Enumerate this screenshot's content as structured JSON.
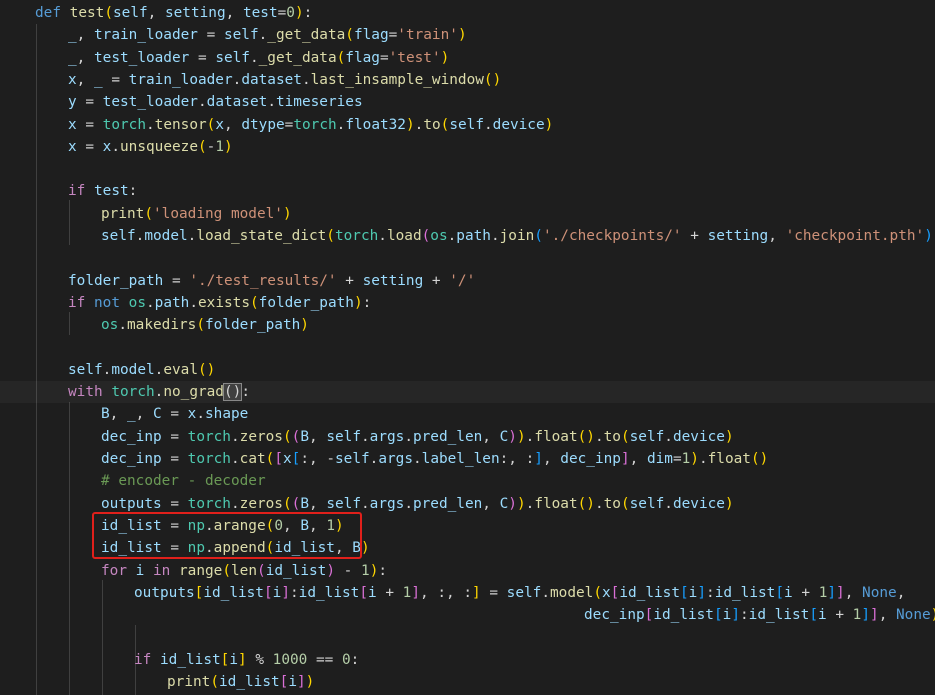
{
  "editor": {
    "lines": [
      [
        [
          "kw",
          "def"
        ],
        [
          "op",
          " "
        ],
        [
          "fn",
          "test"
        ],
        [
          "b1",
          "("
        ],
        [
          "var",
          "self"
        ],
        [
          "op",
          ", "
        ],
        [
          "var",
          "setting"
        ],
        [
          "op",
          ", "
        ],
        [
          "var",
          "test"
        ],
        [
          "op",
          "="
        ],
        [
          "num",
          "0"
        ],
        [
          "b1",
          ")"
        ],
        [
          "op",
          ":"
        ]
      ],
      [
        [
          "var",
          "_"
        ],
        [
          "op",
          ", "
        ],
        [
          "var",
          "train_loader"
        ],
        [
          "op",
          " = "
        ],
        [
          "var",
          "self"
        ],
        [
          "op",
          "."
        ],
        [
          "fn",
          "_get_data"
        ],
        [
          "b1",
          "("
        ],
        [
          "var",
          "flag"
        ],
        [
          "op",
          "="
        ],
        [
          "str",
          "'train'"
        ],
        [
          "b1",
          ")"
        ]
      ],
      [
        [
          "var",
          "_"
        ],
        [
          "op",
          ", "
        ],
        [
          "var",
          "test_loader"
        ],
        [
          "op",
          " = "
        ],
        [
          "var",
          "self"
        ],
        [
          "op",
          "."
        ],
        [
          "fn",
          "_get_data"
        ],
        [
          "b1",
          "("
        ],
        [
          "var",
          "flag"
        ],
        [
          "op",
          "="
        ],
        [
          "str",
          "'test'"
        ],
        [
          "b1",
          ")"
        ]
      ],
      [
        [
          "var",
          "x"
        ],
        [
          "op",
          ", "
        ],
        [
          "var",
          "_"
        ],
        [
          "op",
          " = "
        ],
        [
          "var",
          "train_loader"
        ],
        [
          "op",
          "."
        ],
        [
          "var",
          "dataset"
        ],
        [
          "op",
          "."
        ],
        [
          "fn",
          "last_insample_window"
        ],
        [
          "b1",
          "()"
        ]
      ],
      [
        [
          "var",
          "y"
        ],
        [
          "op",
          " = "
        ],
        [
          "var",
          "test_loader"
        ],
        [
          "op",
          "."
        ],
        [
          "var",
          "dataset"
        ],
        [
          "op",
          "."
        ],
        [
          "var",
          "timeseries"
        ]
      ],
      [
        [
          "var",
          "x"
        ],
        [
          "op",
          " = "
        ],
        [
          "cls",
          "torch"
        ],
        [
          "op",
          "."
        ],
        [
          "fn",
          "tensor"
        ],
        [
          "b1",
          "("
        ],
        [
          "var",
          "x"
        ],
        [
          "op",
          ", "
        ],
        [
          "var",
          "dtype"
        ],
        [
          "op",
          "="
        ],
        [
          "cls",
          "torch"
        ],
        [
          "op",
          "."
        ],
        [
          "var",
          "float32"
        ],
        [
          "b1",
          ")"
        ],
        [
          "op",
          "."
        ],
        [
          "fn",
          "to"
        ],
        [
          "b1",
          "("
        ],
        [
          "var",
          "self"
        ],
        [
          "op",
          "."
        ],
        [
          "var",
          "device"
        ],
        [
          "b1",
          ")"
        ]
      ],
      [
        [
          "var",
          "x"
        ],
        [
          "op",
          " = "
        ],
        [
          "var",
          "x"
        ],
        [
          "op",
          "."
        ],
        [
          "fn",
          "unsqueeze"
        ],
        [
          "b1",
          "("
        ],
        [
          "op",
          "-"
        ],
        [
          "num",
          "1"
        ],
        [
          "b1",
          ")"
        ]
      ],
      [],
      [
        [
          "ctl",
          "if"
        ],
        [
          "op",
          " "
        ],
        [
          "var",
          "test"
        ],
        [
          "op",
          ":"
        ]
      ],
      [
        [
          "fn",
          "print"
        ],
        [
          "b1",
          "("
        ],
        [
          "str",
          "'loading model'"
        ],
        [
          "b1",
          ")"
        ]
      ],
      [
        [
          "var",
          "self"
        ],
        [
          "op",
          "."
        ],
        [
          "var",
          "model"
        ],
        [
          "op",
          "."
        ],
        [
          "fn",
          "load_state_dict"
        ],
        [
          "b1",
          "("
        ],
        [
          "cls",
          "torch"
        ],
        [
          "op",
          "."
        ],
        [
          "fn",
          "load"
        ],
        [
          "b2",
          "("
        ],
        [
          "cls",
          "os"
        ],
        [
          "op",
          "."
        ],
        [
          "var",
          "path"
        ],
        [
          "op",
          "."
        ],
        [
          "fn",
          "join"
        ],
        [
          "b3",
          "("
        ],
        [
          "str",
          "'./checkpoints/'"
        ],
        [
          "op",
          " + "
        ],
        [
          "var",
          "setting"
        ],
        [
          "op",
          ", "
        ],
        [
          "str",
          "'checkpoint.pth'"
        ],
        [
          "b3",
          ")"
        ],
        [
          "b2",
          ")"
        ],
        [
          "b1",
          ")"
        ]
      ],
      [],
      [
        [
          "var",
          "folder_path"
        ],
        [
          "op",
          " = "
        ],
        [
          "str",
          "'./test_results/'"
        ],
        [
          "op",
          " + "
        ],
        [
          "var",
          "setting"
        ],
        [
          "op",
          " + "
        ],
        [
          "str",
          "'/'"
        ]
      ],
      [
        [
          "ctl",
          "if"
        ],
        [
          "op",
          " "
        ],
        [
          "kw",
          "not"
        ],
        [
          "op",
          " "
        ],
        [
          "cls",
          "os"
        ],
        [
          "op",
          "."
        ],
        [
          "var",
          "path"
        ],
        [
          "op",
          "."
        ],
        [
          "fn",
          "exists"
        ],
        [
          "b1",
          "("
        ],
        [
          "var",
          "folder_path"
        ],
        [
          "b1",
          ")"
        ],
        [
          "op",
          ":"
        ]
      ],
      [
        [
          "cls",
          "os"
        ],
        [
          "op",
          "."
        ],
        [
          "fn",
          "makedirs"
        ],
        [
          "b1",
          "("
        ],
        [
          "var",
          "folder_path"
        ],
        [
          "b1",
          ")"
        ]
      ],
      [],
      [
        [
          "var",
          "self"
        ],
        [
          "op",
          "."
        ],
        [
          "var",
          "model"
        ],
        [
          "op",
          "."
        ],
        [
          "fn",
          "eval"
        ],
        [
          "b1",
          "()"
        ]
      ],
      [
        [
          "ctl",
          "with"
        ],
        [
          "op",
          " "
        ],
        [
          "cls",
          "torch"
        ],
        [
          "op",
          "."
        ],
        [
          "fn",
          "no_grad"
        ],
        [
          "bm",
          "()"
        ],
        [
          "op",
          ":"
        ]
      ],
      [
        [
          "var",
          "B"
        ],
        [
          "op",
          ", "
        ],
        [
          "var",
          "_"
        ],
        [
          "op",
          ", "
        ],
        [
          "var",
          "C"
        ],
        [
          "op",
          " = "
        ],
        [
          "var",
          "x"
        ],
        [
          "op",
          "."
        ],
        [
          "var",
          "shape"
        ]
      ],
      [
        [
          "var",
          "dec_inp"
        ],
        [
          "op",
          " = "
        ],
        [
          "cls",
          "torch"
        ],
        [
          "op",
          "."
        ],
        [
          "fn",
          "zeros"
        ],
        [
          "b1",
          "("
        ],
        [
          "b2",
          "("
        ],
        [
          "var",
          "B"
        ],
        [
          "op",
          ", "
        ],
        [
          "var",
          "self"
        ],
        [
          "op",
          "."
        ],
        [
          "var",
          "args"
        ],
        [
          "op",
          "."
        ],
        [
          "var",
          "pred_len"
        ],
        [
          "op",
          ", "
        ],
        [
          "var",
          "C"
        ],
        [
          "b2",
          ")"
        ],
        [
          "b1",
          ")"
        ],
        [
          "op",
          "."
        ],
        [
          "fn",
          "float"
        ],
        [
          "b1",
          "()"
        ],
        [
          "op",
          "."
        ],
        [
          "fn",
          "to"
        ],
        [
          "b1",
          "("
        ],
        [
          "var",
          "self"
        ],
        [
          "op",
          "."
        ],
        [
          "var",
          "device"
        ],
        [
          "b1",
          ")"
        ]
      ],
      [
        [
          "var",
          "dec_inp"
        ],
        [
          "op",
          " = "
        ],
        [
          "cls",
          "torch"
        ],
        [
          "op",
          "."
        ],
        [
          "fn",
          "cat"
        ],
        [
          "b1",
          "("
        ],
        [
          "b2",
          "["
        ],
        [
          "var",
          "x"
        ],
        [
          "b3",
          "["
        ],
        [
          "op",
          ":, -"
        ],
        [
          "var",
          "self"
        ],
        [
          "op",
          "."
        ],
        [
          "var",
          "args"
        ],
        [
          "op",
          "."
        ],
        [
          "var",
          "label_len"
        ],
        [
          "op",
          ":, :"
        ],
        [
          "b3",
          "]"
        ],
        [
          "op",
          ", "
        ],
        [
          "var",
          "dec_inp"
        ],
        [
          "b2",
          "]"
        ],
        [
          "op",
          ", "
        ],
        [
          "var",
          "dim"
        ],
        [
          "op",
          "="
        ],
        [
          "num",
          "1"
        ],
        [
          "b1",
          ")"
        ],
        [
          "op",
          "."
        ],
        [
          "fn",
          "float"
        ],
        [
          "b1",
          "()"
        ]
      ],
      [
        [
          "cmt",
          "# encoder - decoder"
        ]
      ],
      [
        [
          "var",
          "outputs"
        ],
        [
          "op",
          " = "
        ],
        [
          "cls",
          "torch"
        ],
        [
          "op",
          "."
        ],
        [
          "fn",
          "zeros"
        ],
        [
          "b1",
          "("
        ],
        [
          "b2",
          "("
        ],
        [
          "var",
          "B"
        ],
        [
          "op",
          ", "
        ],
        [
          "var",
          "self"
        ],
        [
          "op",
          "."
        ],
        [
          "var",
          "args"
        ],
        [
          "op",
          "."
        ],
        [
          "var",
          "pred_len"
        ],
        [
          "op",
          ", "
        ],
        [
          "var",
          "C"
        ],
        [
          "b2",
          ")"
        ],
        [
          "b1",
          ")"
        ],
        [
          "op",
          "."
        ],
        [
          "fn",
          "float"
        ],
        [
          "b1",
          "()"
        ],
        [
          "op",
          "."
        ],
        [
          "fn",
          "to"
        ],
        [
          "b1",
          "("
        ],
        [
          "var",
          "self"
        ],
        [
          "op",
          "."
        ],
        [
          "var",
          "device"
        ],
        [
          "b1",
          ")"
        ]
      ],
      [
        [
          "var",
          "id_list"
        ],
        [
          "op",
          " = "
        ],
        [
          "cls",
          "np"
        ],
        [
          "op",
          "."
        ],
        [
          "fn",
          "arange"
        ],
        [
          "b1",
          "("
        ],
        [
          "num",
          "0"
        ],
        [
          "op",
          ", "
        ],
        [
          "var",
          "B"
        ],
        [
          "op",
          ", "
        ],
        [
          "num",
          "1"
        ],
        [
          "b1",
          ")"
        ]
      ],
      [
        [
          "var",
          "id_list"
        ],
        [
          "op",
          " = "
        ],
        [
          "cls",
          "np"
        ],
        [
          "op",
          "."
        ],
        [
          "fn",
          "append"
        ],
        [
          "b1",
          "("
        ],
        [
          "var",
          "id_list"
        ],
        [
          "op",
          ", "
        ],
        [
          "var",
          "B"
        ],
        [
          "b1",
          ")"
        ]
      ],
      [
        [
          "ctl",
          "for"
        ],
        [
          "op",
          " "
        ],
        [
          "var",
          "i"
        ],
        [
          "op",
          " "
        ],
        [
          "ctl",
          "in"
        ],
        [
          "op",
          " "
        ],
        [
          "fn",
          "range"
        ],
        [
          "b1",
          "("
        ],
        [
          "fn",
          "len"
        ],
        [
          "b2",
          "("
        ],
        [
          "var",
          "id_list"
        ],
        [
          "b2",
          ")"
        ],
        [
          "op",
          " - "
        ],
        [
          "num",
          "1"
        ],
        [
          "b1",
          ")"
        ],
        [
          "op",
          ":"
        ]
      ],
      [
        [
          "var",
          "outputs"
        ],
        [
          "b1",
          "["
        ],
        [
          "var",
          "id_list"
        ],
        [
          "b2",
          "["
        ],
        [
          "var",
          "i"
        ],
        [
          "b2",
          "]"
        ],
        [
          "op",
          ":"
        ],
        [
          "var",
          "id_list"
        ],
        [
          "b2",
          "["
        ],
        [
          "var",
          "i"
        ],
        [
          "op",
          " + "
        ],
        [
          "num",
          "1"
        ],
        [
          "b2",
          "]"
        ],
        [
          "op",
          ", :, :"
        ],
        [
          "b1",
          "]"
        ],
        [
          "op",
          " = "
        ],
        [
          "var",
          "self"
        ],
        [
          "op",
          "."
        ],
        [
          "fn",
          "model"
        ],
        [
          "b1",
          "("
        ],
        [
          "var",
          "x"
        ],
        [
          "b2",
          "["
        ],
        [
          "var",
          "id_list"
        ],
        [
          "b3",
          "["
        ],
        [
          "var",
          "i"
        ],
        [
          "b3",
          "]"
        ],
        [
          "op",
          ":"
        ],
        [
          "var",
          "id_list"
        ],
        [
          "b3",
          "["
        ],
        [
          "var",
          "i"
        ],
        [
          "op",
          " + "
        ],
        [
          "num",
          "1"
        ],
        [
          "b3",
          "]"
        ],
        [
          "b2",
          "]"
        ],
        [
          "op",
          ", "
        ],
        [
          "kw",
          "None"
        ],
        [
          "op",
          ","
        ]
      ],
      [
        [
          "var",
          "dec_inp"
        ],
        [
          "b2",
          "["
        ],
        [
          "var",
          "id_list"
        ],
        [
          "b3",
          "["
        ],
        [
          "var",
          "i"
        ],
        [
          "b3",
          "]"
        ],
        [
          "op",
          ":"
        ],
        [
          "var",
          "id_list"
        ],
        [
          "b3",
          "["
        ],
        [
          "var",
          "i"
        ],
        [
          "op",
          " + "
        ],
        [
          "num",
          "1"
        ],
        [
          "b3",
          "]"
        ],
        [
          "b2",
          "]"
        ],
        [
          "op",
          ", "
        ],
        [
          "kw",
          "None"
        ],
        [
          "b1",
          ")"
        ]
      ],
      [],
      [
        [
          "ctl",
          "if"
        ],
        [
          "op",
          " "
        ],
        [
          "var",
          "id_list"
        ],
        [
          "b1",
          "["
        ],
        [
          "var",
          "i"
        ],
        [
          "b1",
          "]"
        ],
        [
          "op",
          " % "
        ],
        [
          "num",
          "1000"
        ],
        [
          "op",
          " == "
        ],
        [
          "num",
          "0"
        ],
        [
          "op",
          ":"
        ]
      ],
      [
        [
          "fn",
          "print"
        ],
        [
          "b1",
          "("
        ],
        [
          "var",
          "id_list"
        ],
        [
          "b2",
          "["
        ],
        [
          "var",
          "i"
        ],
        [
          "b2",
          "]"
        ],
        [
          "b1",
          ")"
        ]
      ]
    ]
  }
}
